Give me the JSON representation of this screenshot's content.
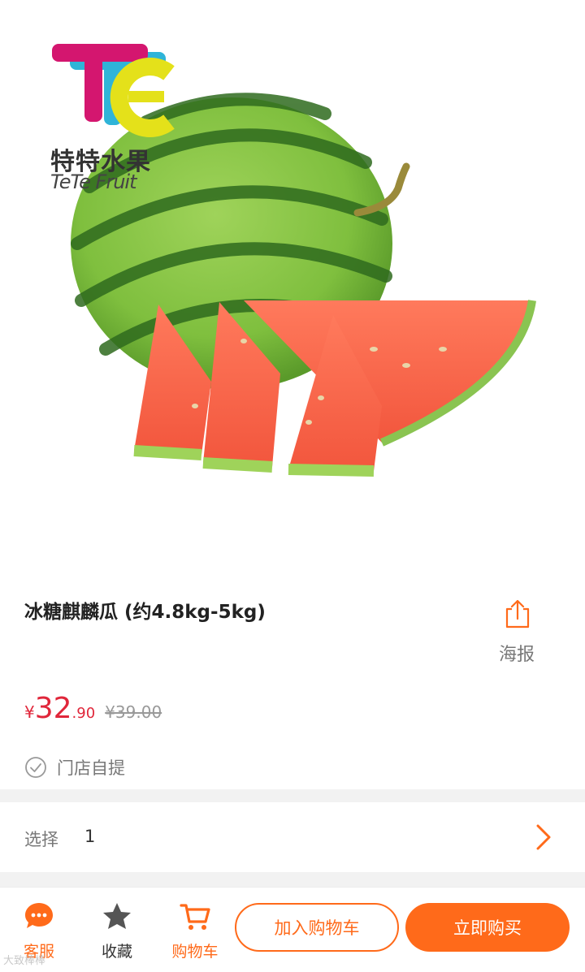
{
  "brand": {
    "name_cn": "特特水果",
    "name_en": "TeTe Fruit"
  },
  "product": {
    "title": "冰糖麒麟瓜 (约4.8kg-5kg)",
    "poster_label": "海报",
    "price": {
      "currency": "¥",
      "integer": "32",
      "decimal": ".90",
      "original": "¥39.00"
    },
    "pickup_label": "门店自提"
  },
  "selection": {
    "label": "选择",
    "value": "1"
  },
  "bottom_bar": {
    "service_label": "客服",
    "favorite_label": "收藏",
    "cart_label": "购物车",
    "add_to_cart_label": "加入购物车",
    "buy_now_label": "立即购买"
  },
  "watermark": "大致棒棒",
  "colors": {
    "accent": "#ff6a1a",
    "price": "#e0263a"
  },
  "icons": {
    "poster": "share-icon",
    "pickup": "check-circle-icon",
    "select": "chevron-right-icon",
    "service": "chat-bubble-icon",
    "favorite": "star-icon",
    "cart": "shopping-cart-icon"
  }
}
